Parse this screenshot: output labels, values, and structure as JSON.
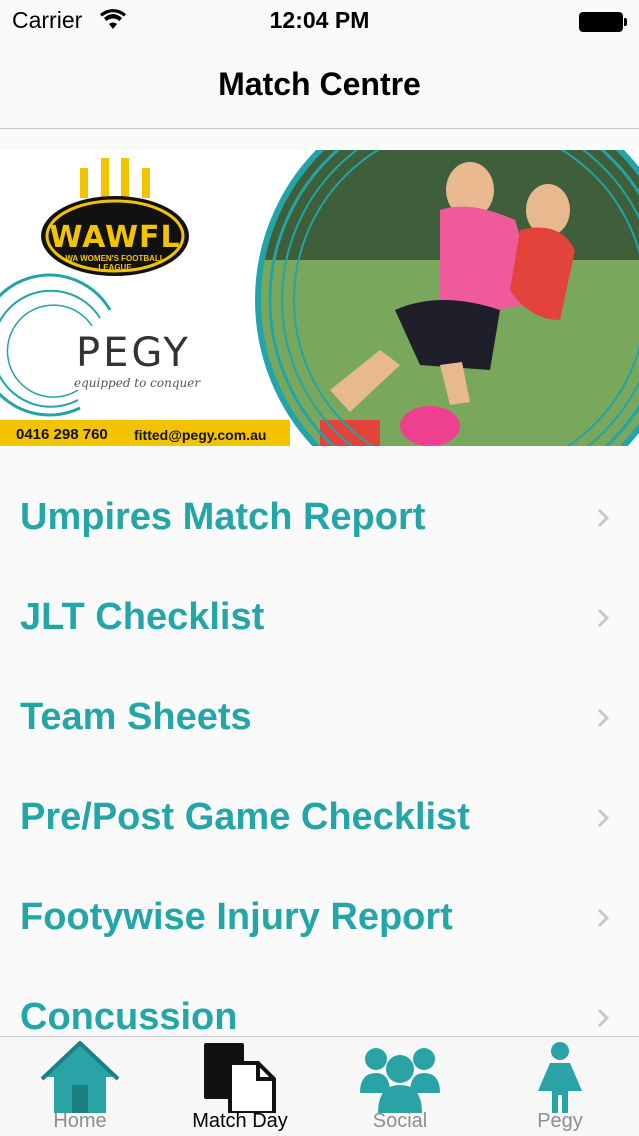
{
  "status": {
    "carrier": "Carrier",
    "time": "12:04 PM"
  },
  "nav": {
    "title": "Match Centre"
  },
  "banner": {
    "league_logo": "WAWFL",
    "league_subtitle": "WA WOMEN'S FOOTBALL LEAGUE",
    "sponsor_name": "PEGY",
    "sponsor_tagline": "equipped to conquer",
    "phone": "0416 298 760",
    "email": "fitted@pegy.com.au"
  },
  "menu": {
    "items": [
      {
        "label": "Umpires Match Report"
      },
      {
        "label": "JLT Checklist"
      },
      {
        "label": "Team Sheets"
      },
      {
        "label": "Pre/Post Game Checklist"
      },
      {
        "label": "Footywise Injury Report"
      },
      {
        "label": "Concussion"
      }
    ]
  },
  "tabs": [
    {
      "label": "Home",
      "icon": "home-icon"
    },
    {
      "label": "Match Day",
      "icon": "documents-icon"
    },
    {
      "label": "Social",
      "icon": "group-icon"
    },
    {
      "label": "Pegy",
      "icon": "woman-icon"
    }
  ],
  "colors": {
    "accent": "#24a5a8",
    "tab_icon": "#2aa3a6",
    "active": "#000000",
    "banner_yellow": "#f2c300"
  }
}
